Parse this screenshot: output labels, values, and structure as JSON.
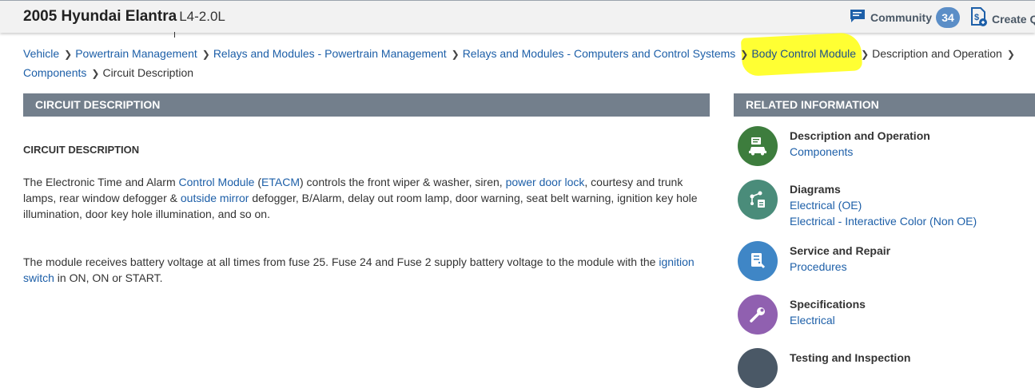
{
  "header": {
    "vehicle_title": "2005 Hyundai Elantra",
    "engine": "L4-2.0L",
    "community_label": "Community",
    "community_count": "34",
    "create_label": "Create Q"
  },
  "breadcrumb": {
    "items": [
      "Vehicle",
      "Powertrain Management",
      "Relays and Modules - Powertrain Management",
      "Relays and Modules - Computers and Control Systems",
      "Body Control Module",
      "Description and Operation",
      "Components",
      "Circuit Description"
    ],
    "highlight_color": "#ffff33"
  },
  "main": {
    "section_header": "CIRCUIT DESCRIPTION",
    "subtitle": "CIRCUIT DESCRIPTION",
    "p1": {
      "t1": "The Electronic Time and Alarm ",
      "link1": "Control Module",
      "t2": " (",
      "link2": "ETACM",
      "t3": ") controls the front wiper & washer, siren, ",
      "link3": "power door lock",
      "t4": ", courtesy and trunk lamps, rear window defogger & ",
      "link4": "outside mirror",
      "t5": " defogger, B/Alarm, delay out room lamp, door warning, seat belt warning, ignition key hole illumination, door key hole illumination, and so on."
    },
    "p2": {
      "t1": "The module receives battery voltage at all times from fuse 25. Fuse 24 and Fuse 2 supply battery voltage to the module with the ",
      "link1": "ignition switch",
      "t2": " in ON, ON or START."
    }
  },
  "related": {
    "header": "RELATED INFORMATION",
    "items": [
      {
        "title": "Description and Operation",
        "links": [
          "Components"
        ],
        "color": "#3d7d3d",
        "icon": "car-info-icon"
      },
      {
        "title": "Diagrams",
        "links": [
          "Electrical (OE)",
          "Electrical - Interactive Color (Non OE)"
        ],
        "color": "#4a8c7a",
        "icon": "diagram-icon"
      },
      {
        "title": "Service and Repair",
        "links": [
          "Procedures"
        ],
        "color": "#3f86c6",
        "icon": "service-icon"
      },
      {
        "title": "Specifications",
        "links": [
          "Electrical"
        ],
        "color": "#9060b0",
        "icon": "wrench-icon"
      },
      {
        "title": "Testing and Inspection",
        "links": [],
        "color": "#4a5866",
        "icon": "testing-icon"
      }
    ]
  },
  "colors": {
    "link": "#1d5fa8",
    "section_header_bg": "#737f8c",
    "badge": "#5b8ec7"
  }
}
